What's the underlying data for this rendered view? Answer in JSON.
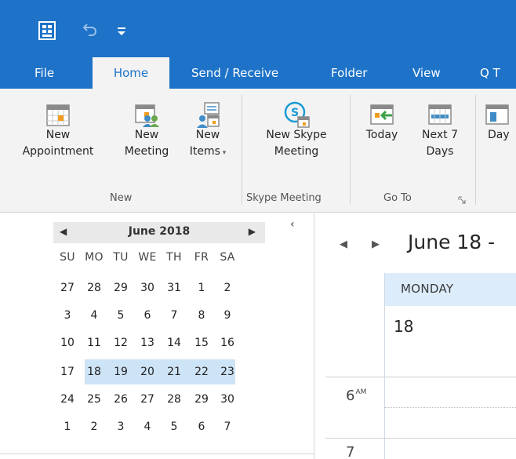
{
  "quick_access": {
    "app_icon": "outlook-app-icon",
    "undo_icon": "undo-icon",
    "customize_icon": "customize-qat-icon"
  },
  "tabs": [
    {
      "label": "File"
    },
    {
      "label": "Home"
    },
    {
      "label": "Send / Receive"
    },
    {
      "label": "Folder"
    },
    {
      "label": "View"
    },
    {
      "label": "Q T"
    }
  ],
  "ribbon": {
    "new_appointment": {
      "line1": "New",
      "line2": "Appointment"
    },
    "new_meeting": {
      "line1": "New",
      "line2": "Meeting"
    },
    "new_items": {
      "line1": "New",
      "line2": "Items"
    },
    "new_skype": {
      "line1": "New Skype",
      "line2": "Meeting"
    },
    "today": {
      "line1": "Today"
    },
    "next7": {
      "line1": "Next 7",
      "line2": "Days"
    },
    "day": {
      "line1": "Day"
    },
    "groups": {
      "new": "New",
      "skype": "Skype Meeting",
      "goto": "Go To"
    }
  },
  "mini_calendar": {
    "title": "June 2018",
    "prev": "◀",
    "next": "▶",
    "weekdays": [
      "SU",
      "MO",
      "TU",
      "WE",
      "TH",
      "FR",
      "SA"
    ],
    "weeks": [
      [
        "27",
        "28",
        "29",
        "30",
        "31",
        "1",
        "2"
      ],
      [
        "3",
        "4",
        "5",
        "6",
        "7",
        "8",
        "9"
      ],
      [
        "10",
        "11",
        "12",
        "13",
        "14",
        "15",
        "16"
      ],
      [
        "17",
        "18",
        "19",
        "20",
        "21",
        "22",
        "23"
      ],
      [
        "24",
        "25",
        "26",
        "27",
        "28",
        "29",
        "30"
      ],
      [
        "1",
        "2",
        "3",
        "4",
        "5",
        "6",
        "7"
      ]
    ],
    "collapse": "‹"
  },
  "day_view": {
    "prev": "◀",
    "next": "▶",
    "title": "June 18 -",
    "day_name": "MONDAY",
    "day_number": "18",
    "hours": [
      {
        "num": "6",
        "suffix": "AM"
      },
      {
        "num": "7",
        "suffix": ""
      }
    ]
  },
  "colors": {
    "brand": "#1e73c8",
    "ribbon_bg": "#f3f3f3",
    "week_highlight": "#cde3f6",
    "day_header": "#dcecfb"
  }
}
